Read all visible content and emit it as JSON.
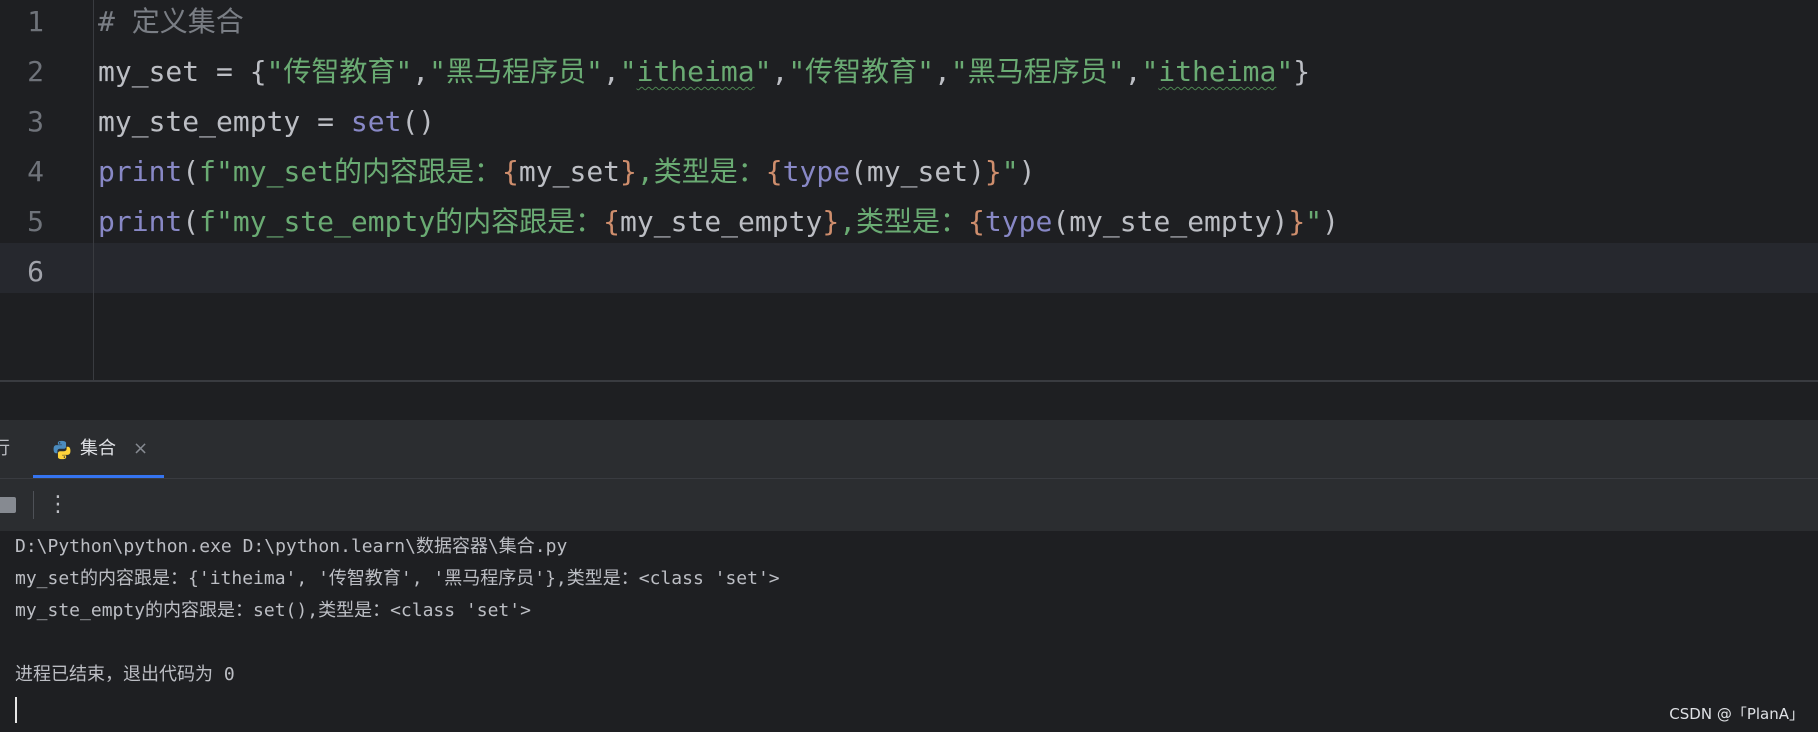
{
  "editor": {
    "lines": [
      {
        "num": "1",
        "tokens": [
          {
            "t": "# 定义集合",
            "c": "comment"
          }
        ]
      },
      {
        "num": "2",
        "tokens": [
          {
            "t": "my_set = ",
            "c": "ident"
          },
          {
            "t": "{",
            "c": "ident"
          },
          {
            "t": "\"传智教育\"",
            "c": "str"
          },
          {
            "t": ",",
            "c": "ident"
          },
          {
            "t": "\"黑马程序员\"",
            "c": "str"
          },
          {
            "t": ",",
            "c": "ident"
          },
          {
            "t": "\"",
            "c": "str"
          },
          {
            "t": "itheima",
            "c": "str typo"
          },
          {
            "t": "\"",
            "c": "str"
          },
          {
            "t": ",",
            "c": "ident"
          },
          {
            "t": "\"传智教育\"",
            "c": "str"
          },
          {
            "t": ",",
            "c": "ident"
          },
          {
            "t": "\"黑马程序员\"",
            "c": "str"
          },
          {
            "t": ",",
            "c": "ident"
          },
          {
            "t": "\"",
            "c": "str"
          },
          {
            "t": "itheima",
            "c": "str typo"
          },
          {
            "t": "\"",
            "c": "str"
          },
          {
            "t": "}",
            "c": "ident"
          }
        ]
      },
      {
        "num": "3",
        "tokens": [
          {
            "t": "my_ste_empty = ",
            "c": "ident"
          },
          {
            "t": "set",
            "c": "builtin"
          },
          {
            "t": "()",
            "c": "ident"
          }
        ]
      },
      {
        "num": "4",
        "tokens": [
          {
            "t": "print",
            "c": "builtin"
          },
          {
            "t": "(",
            "c": "ident"
          },
          {
            "t": "f\"my_set的内容跟是：",
            "c": "str"
          },
          {
            "t": "{",
            "c": "brace"
          },
          {
            "t": "my_set",
            "c": "ident"
          },
          {
            "t": "}",
            "c": "brace"
          },
          {
            "t": ",类型是：",
            "c": "str"
          },
          {
            "t": "{",
            "c": "brace"
          },
          {
            "t": "type",
            "c": "builtin"
          },
          {
            "t": "(my_set)",
            "c": "ident"
          },
          {
            "t": "}",
            "c": "brace"
          },
          {
            "t": "\"",
            "c": "str"
          },
          {
            "t": ")",
            "c": "ident"
          }
        ]
      },
      {
        "num": "5",
        "tokens": [
          {
            "t": "print",
            "c": "builtin"
          },
          {
            "t": "(",
            "c": "ident"
          },
          {
            "t": "f\"my_ste_empty的内容跟是：",
            "c": "str"
          },
          {
            "t": "{",
            "c": "brace"
          },
          {
            "t": "my_ste_empty",
            "c": "ident"
          },
          {
            "t": "}",
            "c": "brace"
          },
          {
            "t": ",类型是：",
            "c": "str"
          },
          {
            "t": "{",
            "c": "brace"
          },
          {
            "t": "type",
            "c": "builtin"
          },
          {
            "t": "(my_ste_empty)",
            "c": "ident"
          },
          {
            "t": "}",
            "c": "brace"
          },
          {
            "t": "\"",
            "c": "str"
          },
          {
            "t": ")",
            "c": "ident"
          }
        ]
      },
      {
        "num": "6",
        "tokens": []
      }
    ],
    "current_line": "6"
  },
  "run_panel": {
    "prev_tab_label": "行",
    "active_tab": {
      "label": "集合",
      "close": "×"
    },
    "more_glyph": "⋮"
  },
  "console": {
    "lines": [
      "D:\\Python\\python.exe D:\\python.learn\\数据容器\\集合.py",
      "my_set的内容跟是：{'itheima', '传智教育', '黑马程序员'},类型是：<class 'set'>",
      "my_ste_empty的内容跟是：set(),类型是：<class 'set'>",
      "",
      "进程已结束，退出代码为 0"
    ]
  },
  "watermark": "CSDN @「PlanA」",
  "colors": {
    "editor_bg": "#1e1f22",
    "panel_bg": "#2b2d30",
    "comment": "#7a7e85",
    "string": "#6aab73",
    "fstring_brace": "#cf8e6d",
    "builtin": "#8888c6",
    "identifier": "#bcbec4",
    "tab_accent": "#3574f0"
  }
}
